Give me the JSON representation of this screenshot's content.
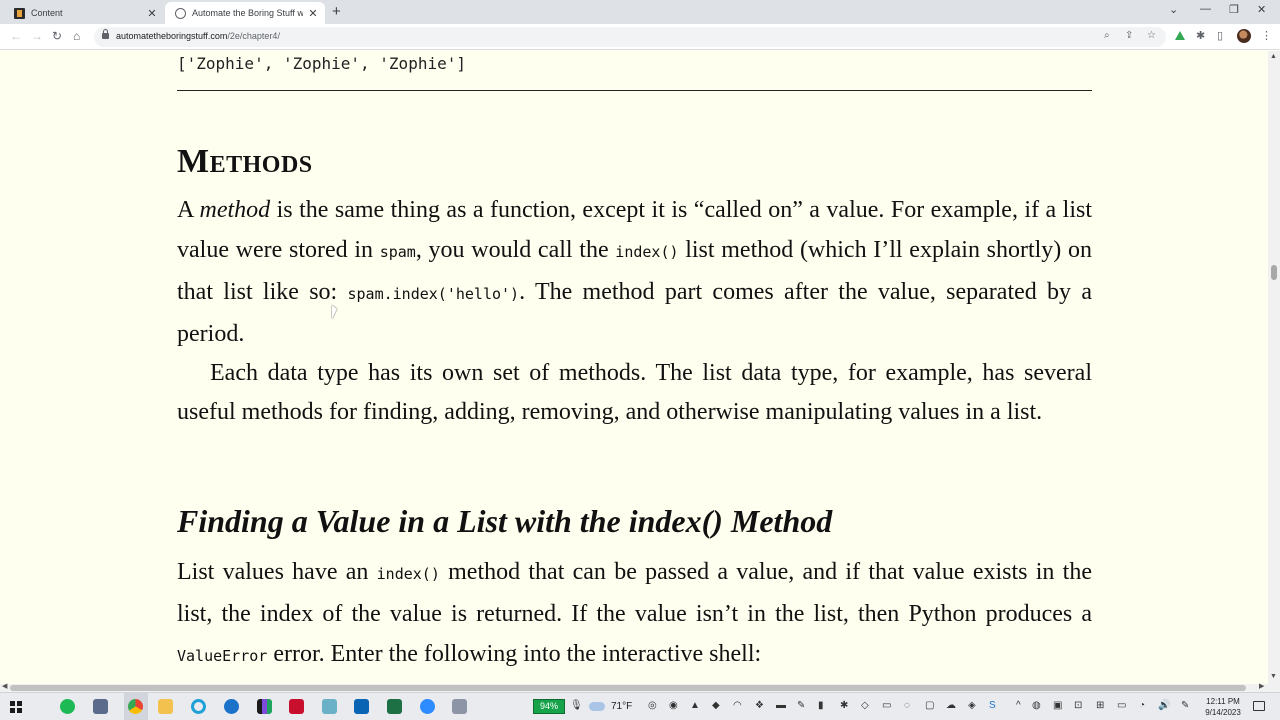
{
  "browser": {
    "tabs": [
      {
        "label": "Content",
        "close": "✕",
        "active": false
      },
      {
        "label": "Automate the Boring Stuff with P…",
        "close": "✕",
        "active": true
      }
    ],
    "new_tab": "+",
    "window_controls": {
      "minimize": "—",
      "maximize": "❐",
      "close": "✕",
      "tab_search": "⌄"
    },
    "nav": {
      "back": "←",
      "forward": "→",
      "reload": "↻",
      "home": "⌂"
    },
    "url_domain": "automatetheboringstuff.com",
    "url_path": "/2e/chapter4/",
    "omnibox_icons": {
      "zoom": "⌕",
      "share": "⇪",
      "bookmark": "☆"
    },
    "toolbar_icons": {
      "extensions": "✱",
      "side_panel": "▯",
      "menu": "⋮"
    }
  },
  "page": {
    "code_output": "['Zophie', 'Zophie', 'Zophie']",
    "section_heading": "Methods",
    "para1": {
      "t1": "A ",
      "em": "method",
      "t2": " is the same thing as a function, except it is “called on” a value. For example, if a list value were stored in ",
      "c1": "spam",
      "t3": ", you would call the ",
      "c2": "index()",
      "t4": " list method (which I’ll explain shortly) on that list like so: ",
      "c3": "spam.index('hello')",
      "t5": ". The method part comes after the value, separated by a period."
    },
    "para2": "Each data type has its own set of methods. The list data type, for example, has several useful methods for finding, adding, removing, and otherwise manipulating values in a list.",
    "subheading": "Finding a Value in a List with the index() Method",
    "para3": {
      "t1": "List values have an ",
      "c1": "index()",
      "t2": " method that can be passed a value, and if that value exists in the list, the index of the value is returned. If the value isn’t in the list, then Python produces a ",
      "c2": "ValueError",
      "t3": " error. Enter the following into the interactive shell:"
    }
  },
  "scrollbar": {
    "up": "▲",
    "down": "▼",
    "left": "◀",
    "right": "▶",
    "position_percent": 34
  },
  "taskbar": {
    "battery": "94%",
    "temperature": "71°F",
    "time": "12:11 PM",
    "date": "9/14/2023",
    "tray": {
      "chevron": "^",
      "volume": "🔊",
      "wifi": "◔",
      "pen": "✎"
    }
  },
  "colors": {
    "page_bg": "#fffff0",
    "tab_strip": "#dee1e6",
    "taskbar": "#e9ebef",
    "battery": "#16a34a"
  }
}
